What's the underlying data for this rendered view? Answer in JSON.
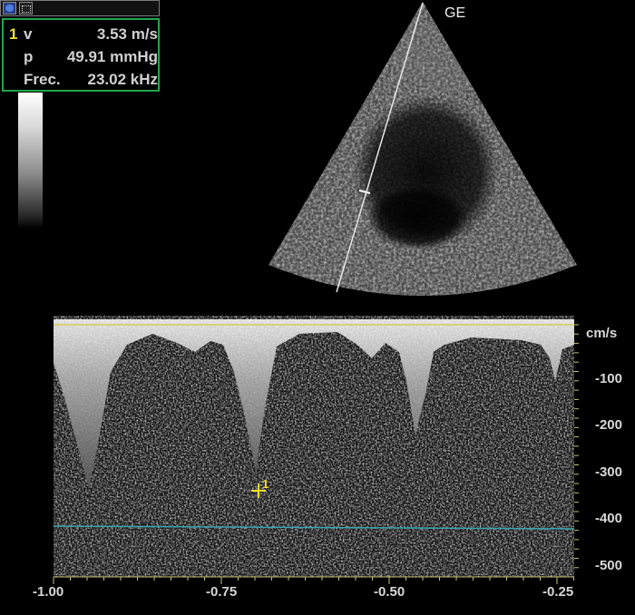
{
  "toolbar": {
    "buttons": [
      {
        "icon": "record-icon"
      },
      {
        "icon": "measure-select-icon"
      }
    ]
  },
  "measurement": {
    "index": "1",
    "rows": [
      {
        "label": "v",
        "value": "3.53 m/s"
      },
      {
        "label": "p",
        "value": "49.91 mmHg"
      },
      {
        "label": "Frec.",
        "value": "23.02 kHz"
      }
    ]
  },
  "sector": {
    "vendor": "GE"
  },
  "doppler": {
    "unit": "cm/s",
    "y_ticks": [
      "-100",
      "-200",
      "-300",
      "-400",
      "-500"
    ],
    "x_ticks": [
      "-1.00",
      "-0.75",
      "-0.50",
      "-0.25"
    ],
    "cursor_label": "1",
    "colors": {
      "baseline": "#d8d07a",
      "cursor_line": "#3aa6b0",
      "cursor_mark": "#f0e02a",
      "accent_box": "#1fa64a"
    }
  }
}
